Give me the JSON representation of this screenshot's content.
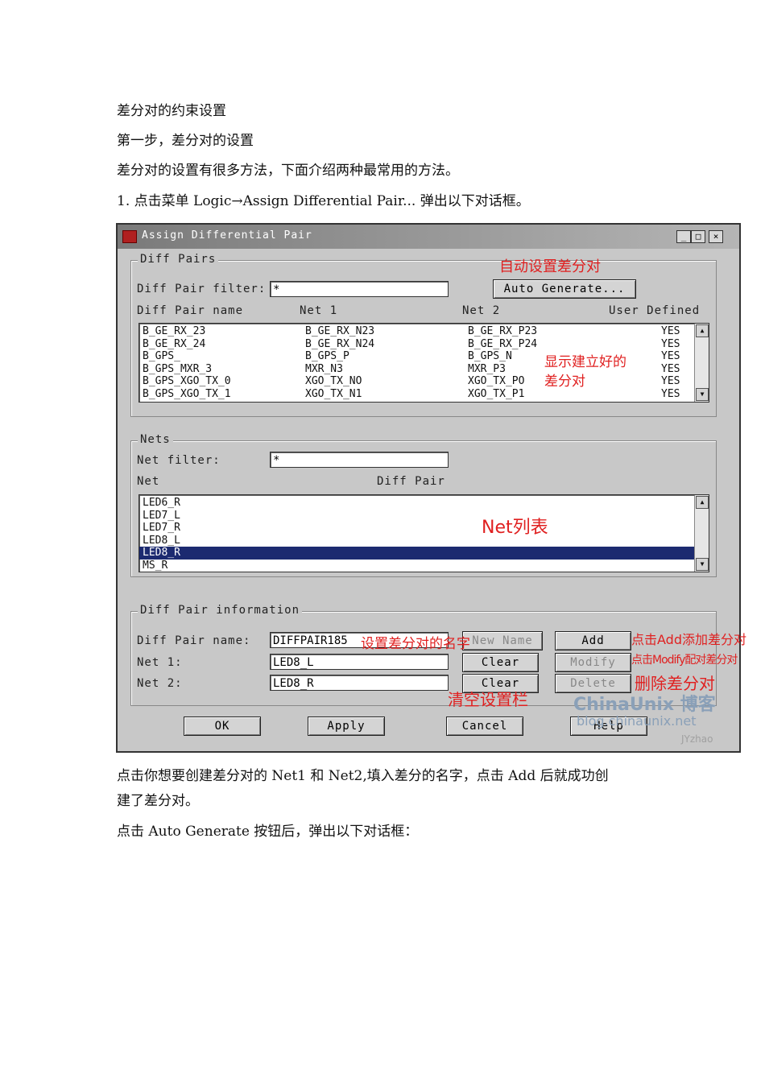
{
  "doc": {
    "heading": "差分对的约束设置",
    "step1": "第一步，差分对的设置",
    "intro": "差分对的设置有很多方法，下面介绍两种最常用的方法。",
    "item1": "1.   点击菜单 Logic→Assign Differential Pair...  弹出以下对话框。",
    "after1a": "点击你想要创建差分对的 Net1 和 Net2,填入差分的名字，点击 Add 后就成功创",
    "after1b": "建了差分对。",
    "after2": "点击 Auto Generate 按钮后，弹出以下对话框："
  },
  "dialog": {
    "title": "Assign Differential Pair",
    "min": "_",
    "max": "□",
    "close": "×",
    "diff_pairs": {
      "group_label": "Diff Pairs",
      "filter_label": "Diff Pair filter:",
      "filter_value": "*",
      "auto_generate": "Auto Generate...",
      "col_name": "Diff Pair name",
      "col_net1": "Net 1",
      "col_net2": "Net 2",
      "col_user": "User Defined",
      "rows": [
        {
          "name": "B_GE_RX_23",
          "net1": "B_GE_RX_N23",
          "net2": "B_GE_RX_P23",
          "user": "YES"
        },
        {
          "name": "B_GE_RX_24",
          "net1": "B_GE_RX_N24",
          "net2": "B_GE_RX_P24",
          "user": "YES"
        },
        {
          "name": "B_GPS_",
          "net1": "B_GPS_P",
          "net2": "B_GPS_N",
          "user": "YES"
        },
        {
          "name": "B_GPS_MXR_3",
          "net1": "MXR_N3",
          "net2": "MXR_P3",
          "user": "YES"
        },
        {
          "name": "B_GPS_XGO_TX_0",
          "net1": "XGO_TX_NO",
          "net2": "XGO_TX_PO",
          "user": "YES"
        },
        {
          "name": "B_GPS_XGO_TX_1",
          "net1": "XGO_TX_N1",
          "net2": "XGO_TX_P1",
          "user": "YES"
        }
      ]
    },
    "nets": {
      "group_label": "Nets",
      "filter_label": "Net filter:",
      "filter_value": "*",
      "col_net": "Net",
      "col_pair": "Diff Pair",
      "rows": [
        "LED6_R",
        "LED7_L",
        "LED7_R",
        "LED8_L",
        "LED8_R",
        "MS_R"
      ],
      "selected_index": 4
    },
    "info": {
      "group_label": "Diff Pair information",
      "name_label": "Diff Pair name:",
      "name_value": "DIFFPAIR185",
      "net1_label": "Net 1:",
      "net1_value": "LED8_L",
      "net2_label": "Net 2:",
      "net2_value": "LED8_R",
      "new_name": "New Name",
      "clear1": "Clear",
      "clear2": "Clear",
      "add": "Add",
      "modify": "Modify",
      "delete": "Delete"
    },
    "buttons": {
      "ok": "OK",
      "apply": "Apply",
      "cancel": "Cancel",
      "help": "Help"
    }
  },
  "annotations": {
    "auto": "自动设置差分对",
    "shown1": "显示建立好的",
    "shown2": "差分对",
    "netlist": "Net列表",
    "setname": "设置差分对的名字",
    "add": "点击Add添加差分对",
    "modify": "点击Modify配对差分对",
    "delete": "删除差分对",
    "clear": "清空设置栏"
  },
  "watermark": {
    "brand": "ChinaUnix 博客",
    "url": "blog.chinaunix.net",
    "author": "JYzhao"
  }
}
